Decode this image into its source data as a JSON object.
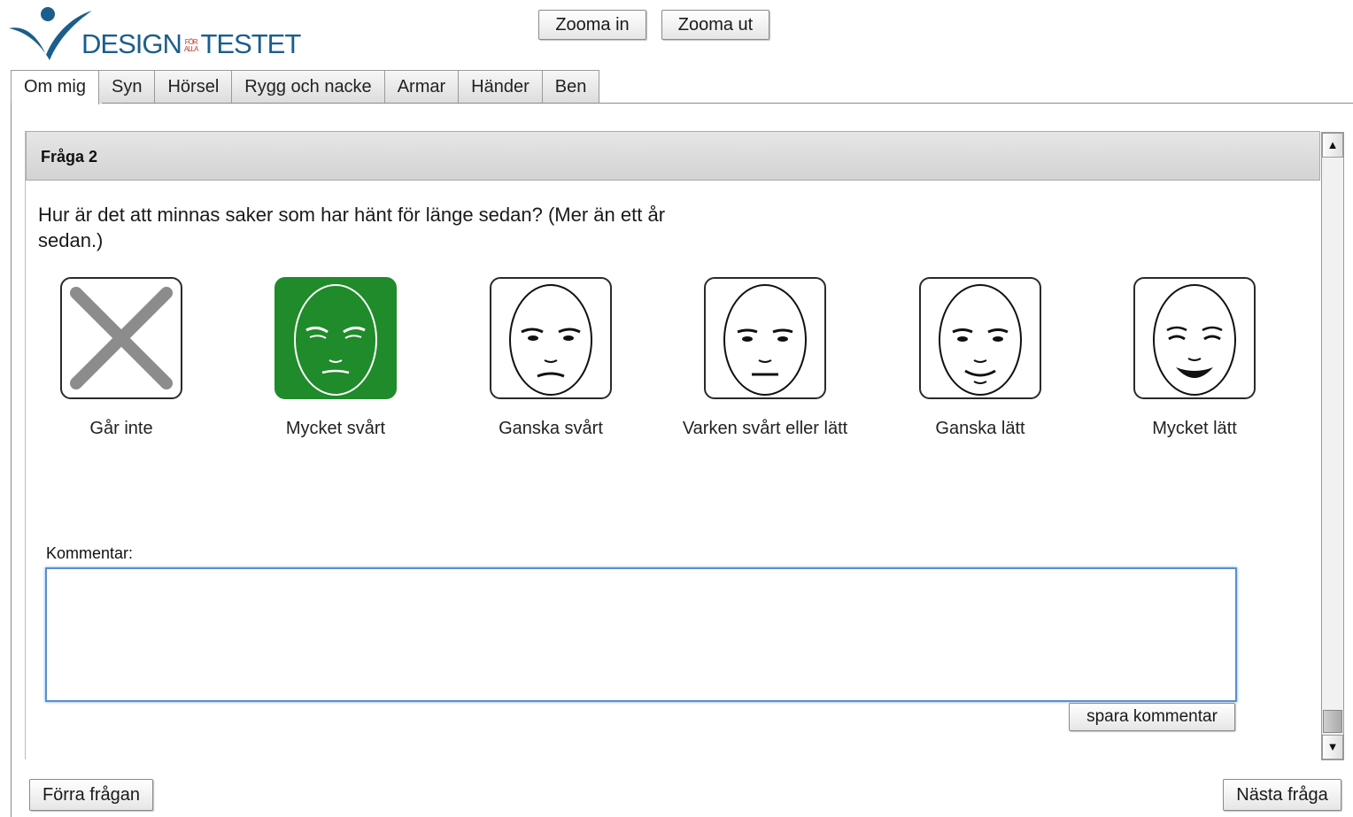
{
  "logo": {
    "main": "DESIGN",
    "small_top": "FÖR",
    "small_bottom": "ALLA",
    "tail": "TESTET"
  },
  "toolbar": {
    "zoom_in": "Zooma in",
    "zoom_out": "Zooma ut"
  },
  "tabs": [
    "Om mig",
    "Syn",
    "Hörsel",
    "Rygg och nacke",
    "Armar",
    "Händer",
    "Ben"
  ],
  "active_tab": "Om mig",
  "question": {
    "title": "Fråga 2",
    "text": "Hur är det att minnas saker som har hänt för länge sedan? (Mer än ett år sedan.)"
  },
  "options": [
    {
      "label": "Går inte",
      "icon": "cross-icon",
      "selected": false
    },
    {
      "label": "Mycket svårt",
      "icon": "face-very-hard-icon",
      "selected": true
    },
    {
      "label": "Ganska svårt",
      "icon": "face-rather-hard-icon",
      "selected": false
    },
    {
      "label": "Varken svårt eller lätt",
      "icon": "face-neutral-icon",
      "selected": false
    },
    {
      "label": "Ganska lätt",
      "icon": "face-rather-easy-icon",
      "selected": false
    },
    {
      "label": "Mycket lätt",
      "icon": "face-very-easy-icon",
      "selected": false
    }
  ],
  "comment": {
    "label": "Kommentar:",
    "value": "",
    "save": "spara kommentar"
  },
  "nav": {
    "prev": "Förra frågan",
    "next": "Nästa fråga"
  },
  "colors": {
    "selected": "#1f8b2a",
    "logo": "#1b5e8c",
    "focus": "#5a8fcf"
  }
}
